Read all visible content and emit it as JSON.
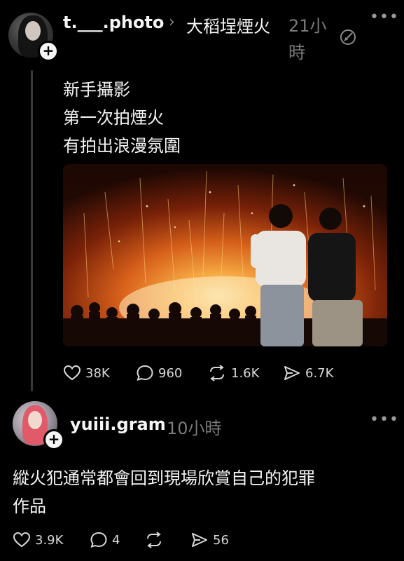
{
  "post": {
    "username": "t.___.photo",
    "community": "大稻埕煙火",
    "time": "21小時",
    "lines": [
      "新手攝影",
      "第一次拍煙火",
      "有拍出浪漫氛圍"
    ],
    "actions": {
      "likes": "38K",
      "comments": "960",
      "reposts": "1.6K",
      "shares": "6.7K"
    }
  },
  "reply": {
    "username": "yuiii.gram",
    "time": "10小時",
    "text_line1": "縱火犯通常都會回到現場欣賞自己的犯罪",
    "text_line2": "作品",
    "actions": {
      "likes": "3.9K",
      "comments": "4",
      "shares": "56"
    }
  },
  "icons": {
    "more": "more-horizontal-icon",
    "follow": "plus-icon",
    "translate": "edit-icon",
    "like": "heart-icon",
    "comment": "comment-bubble-icon",
    "repost": "repost-icon",
    "share": "send-icon"
  },
  "colors": {
    "background": "#000000",
    "text": "#f5f5f5",
    "muted": "#7a7a7a"
  }
}
